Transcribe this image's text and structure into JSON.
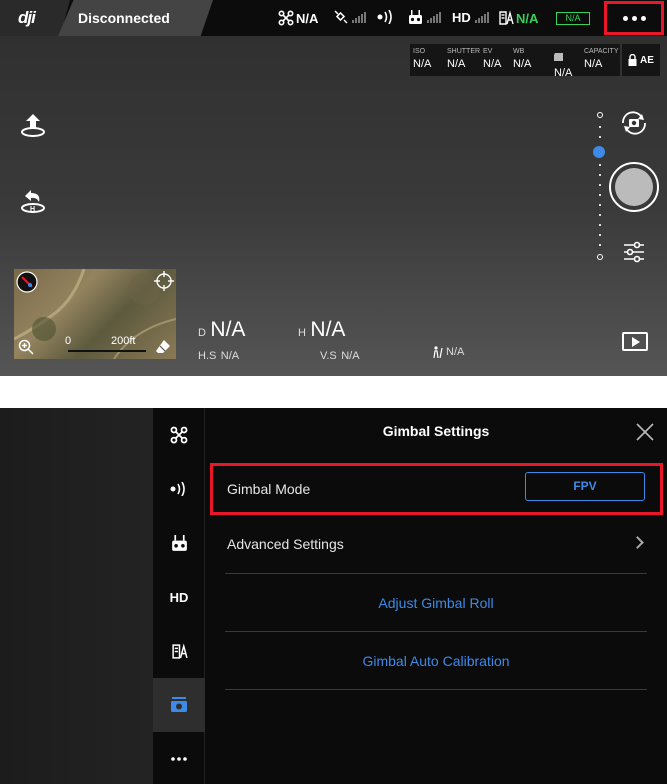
{
  "topbar": {
    "logo_text": "dji",
    "connection_status": "Disconnected",
    "aircraft_status": "N/A",
    "hd_label": "HD",
    "battery_percent": "N/A",
    "battery_box": "N/A"
  },
  "camera_params": [
    {
      "label": "ISO",
      "value": "N/A"
    },
    {
      "label": "SHUTTER",
      "value": "N/A"
    },
    {
      "label": "EV",
      "value": "N/A"
    },
    {
      "label": "WB",
      "value": "N/A"
    },
    {
      "label": "",
      "value": "N/A"
    },
    {
      "label": "CAPACITY",
      "value": "N/A"
    }
  ],
  "ae_label": "AE",
  "map": {
    "scale_start": "0",
    "scale_end": "200ft"
  },
  "telemetry": {
    "d_label": "D",
    "d_value": "N/A",
    "h_label": "H",
    "h_value": "N/A",
    "hs_label": "H.S",
    "hs_value": "N/A",
    "vs_label": "V.S",
    "vs_value": "N/A",
    "dist_value": "N/A"
  },
  "settings": {
    "title": "Gimbal Settings",
    "gimbal_mode_label": "Gimbal Mode",
    "gimbal_mode_value": "FPV",
    "advanced_label": "Advanced Settings",
    "adjust_roll_label": "Adjust Gimbal Roll",
    "auto_calibration_label": "Gimbal Auto Calibration",
    "rail_hd": "HD"
  },
  "colors": {
    "accent": "#3d8ae8",
    "highlight": "#e8172a",
    "battery": "#35d15c"
  }
}
